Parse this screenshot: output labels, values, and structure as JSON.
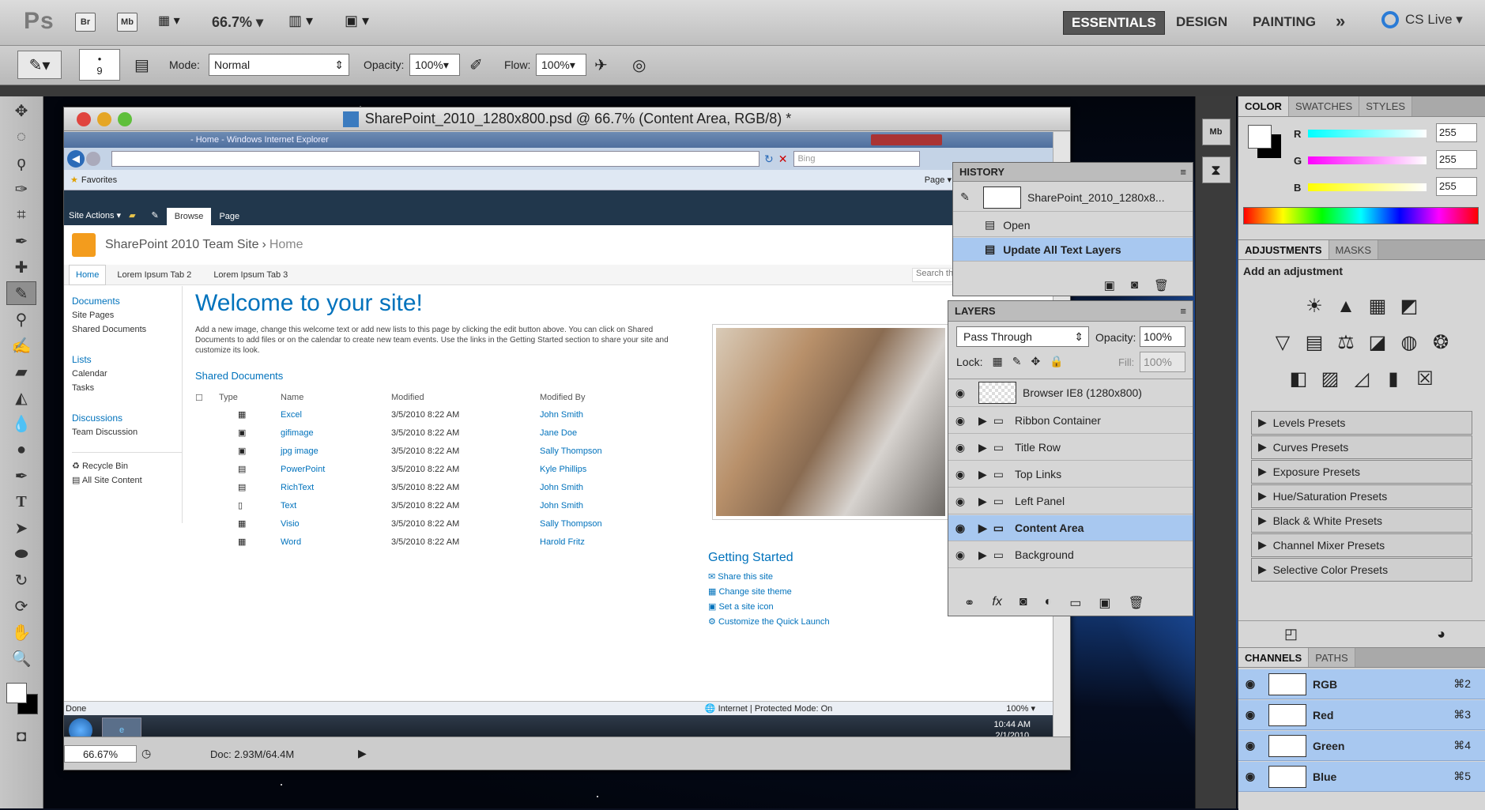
{
  "appbar": {
    "logo": "Ps",
    "br": "Br",
    "mb": "Mb",
    "zoom": "66.7%",
    "workspaces": [
      "ESSENTIALS",
      "DESIGN",
      "PAINTING"
    ],
    "more": "»",
    "cslive": "CS Live"
  },
  "optbar": {
    "brush_size": "9",
    "mode_label": "Mode:",
    "mode_value": "Normal",
    "opacity_label": "Opacity:",
    "opacity_value": "100%",
    "flow_label": "Flow:",
    "flow_value": "100%"
  },
  "document": {
    "title": "SharePoint_2010_1280x800.psd @ 66.7% (Content Area, RGB/8) *",
    "zoom": "66.67%",
    "doc_info": "Doc: 2.93M/64.4M"
  },
  "ie": {
    "window_title": "- Home - Windows Internet Explorer",
    "search_placeholder": "Bing",
    "favorites": "Favorites",
    "page_menu": "Page",
    "status": "Done",
    "zone": "Internet | Protected Mode: On",
    "zoom": "100%",
    "time": "10:44 AM",
    "date": "2/1/2010"
  },
  "sp": {
    "site_actions": "Site Actions",
    "browse": "Browse",
    "page": "Page",
    "site_title": "SharePoint 2010 Team Site",
    "breadcrumb_sep": "›",
    "breadcrumb": "Home",
    "tabs": [
      "Home",
      "Lorem Ipsum Tab 2",
      "Lorem Ipsum Tab 3"
    ],
    "search": "Search this site...",
    "nav": {
      "sec1": "Documents",
      "sec1_items": [
        "Site Pages",
        "Shared Documents"
      ],
      "sec2": "Lists",
      "sec2_items": [
        "Calendar",
        "Tasks"
      ],
      "sec3": "Discussions",
      "sec3_items": [
        "Team Discussion"
      ],
      "bottom": [
        "Recycle Bin",
        "All Site Content"
      ]
    },
    "welcome": "Welcome to your site!",
    "intro": "Add a new image, change this welcome text or add new lists to this page by clicking the edit button above. You can click on Shared Documents to add files or on the calendar to create new team events. Use the links in the Getting Started section to share your site and customize its look.",
    "shared_docs": "Shared Documents",
    "cols": [
      "Type",
      "Name",
      "Modified",
      "Modified By"
    ],
    "rows": [
      [
        "Excel",
        "3/5/2010 8:22 AM",
        "John Smith"
      ],
      [
        "gifimage",
        "3/5/2010 8:22 AM",
        "Jane Doe"
      ],
      [
        "jpg image",
        "3/5/2010 8:22 AM",
        "Sally Thompson"
      ],
      [
        "PowerPoint",
        "3/5/2010 8:22 AM",
        "Kyle Phillips"
      ],
      [
        "RichText",
        "3/5/2010 8:22 AM",
        "John Smith"
      ],
      [
        "Text",
        "3/5/2010 8:22 AM",
        "John Smith"
      ],
      [
        "Visio",
        "3/5/2010 8:22 AM",
        "Sally Thompson"
      ],
      [
        "Word",
        "3/5/2010 8:22 AM",
        "Harold Fritz"
      ]
    ],
    "getting_started": "Getting Started",
    "gs_items": [
      "Share this site",
      "Change site theme",
      "Set a site icon",
      "Customize the Quick Launch"
    ]
  },
  "history": {
    "title": "HISTORY",
    "snapshot": "SharePoint_2010_1280x8...",
    "items": [
      "Open",
      "Update All Text Layers"
    ]
  },
  "layers": {
    "title": "LAYERS",
    "blend": "Pass Through",
    "opacity_label": "Opacity:",
    "opacity": "100%",
    "lock_label": "Lock:",
    "fill_label": "Fill:",
    "fill": "100%",
    "items": [
      "Browser IE8 (1280x800)",
      "Ribbon Container",
      "Title Row",
      "Top Links",
      "Left Panel",
      "Content Area",
      "Background"
    ]
  },
  "color": {
    "tabs": [
      "COLOR",
      "SWATCHES",
      "STYLES"
    ],
    "r_label": "R",
    "g_label": "G",
    "b_label": "B",
    "r": "255",
    "g": "255",
    "b": "255"
  },
  "adjust": {
    "tabs": [
      "ADJUSTMENTS",
      "MASKS"
    ],
    "heading": "Add an adjustment",
    "presets": [
      "Levels Presets",
      "Curves Presets",
      "Exposure Presets",
      "Hue/Saturation Presets",
      "Black & White Presets",
      "Channel Mixer Presets",
      "Selective Color Presets"
    ]
  },
  "channels": {
    "tabs": [
      "CHANNELS",
      "PATHS"
    ],
    "items": [
      [
        "RGB",
        "⌘2"
      ],
      [
        "Red",
        "⌘3"
      ],
      [
        "Green",
        "⌘4"
      ],
      [
        "Blue",
        "⌘5"
      ]
    ]
  }
}
